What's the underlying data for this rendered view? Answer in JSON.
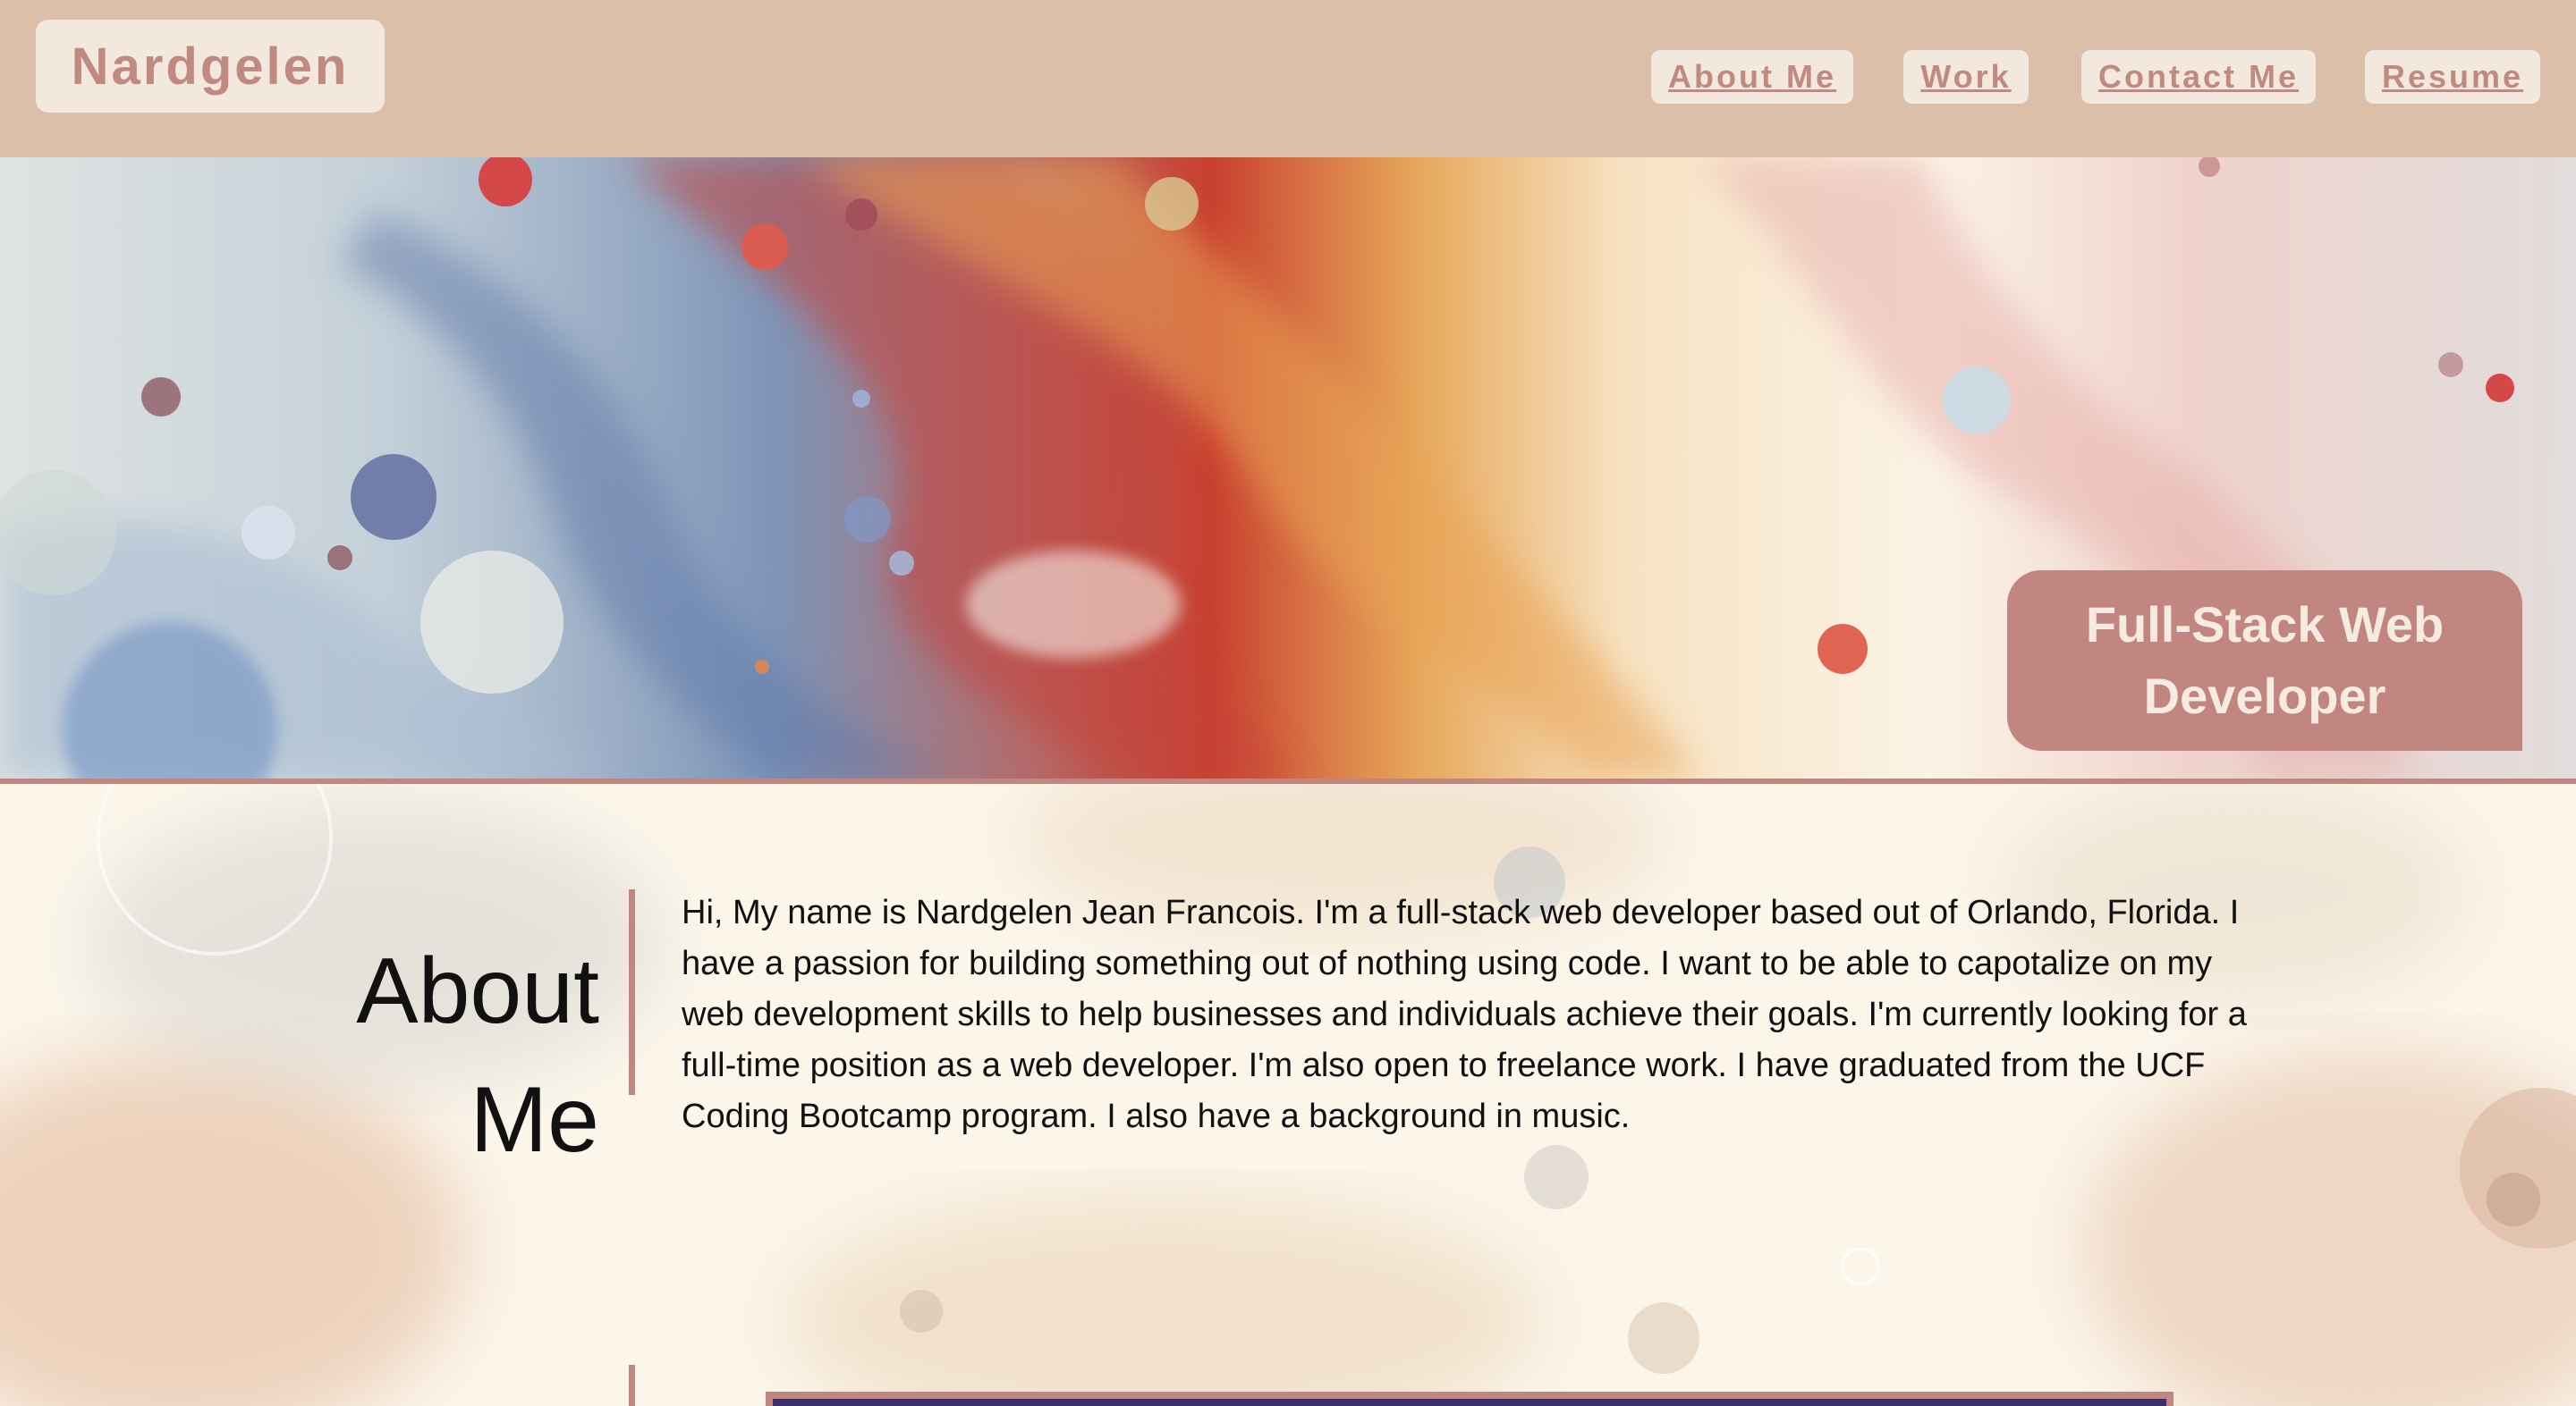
{
  "header": {
    "brand": "Nardgelen",
    "nav": [
      "About Me",
      "Work",
      "Contact Me",
      "Resume"
    ]
  },
  "hero": {
    "badge": "Full-Stack Web Developer"
  },
  "about": {
    "heading": "About Me",
    "body": "Hi, My name is Nardgelen Jean Francois. I'm a full-stack web developer based out of Orlando, Florida. I have a passion for building something out of nothing using code. I want to be able to capotalize on my web development skills to help businesses and individuals achieve their goals. I'm currently looking for a full-time position as a web developer. I'm also open to freelance work. I have graduated from the UCF Coding Bootcamp program. I also have a background in music."
  },
  "colors": {
    "header_bg": "#dcbfa8",
    "accent": "#c0867f",
    "button_bg": "#f2e8de",
    "page_bg": "#fbf6ec"
  }
}
